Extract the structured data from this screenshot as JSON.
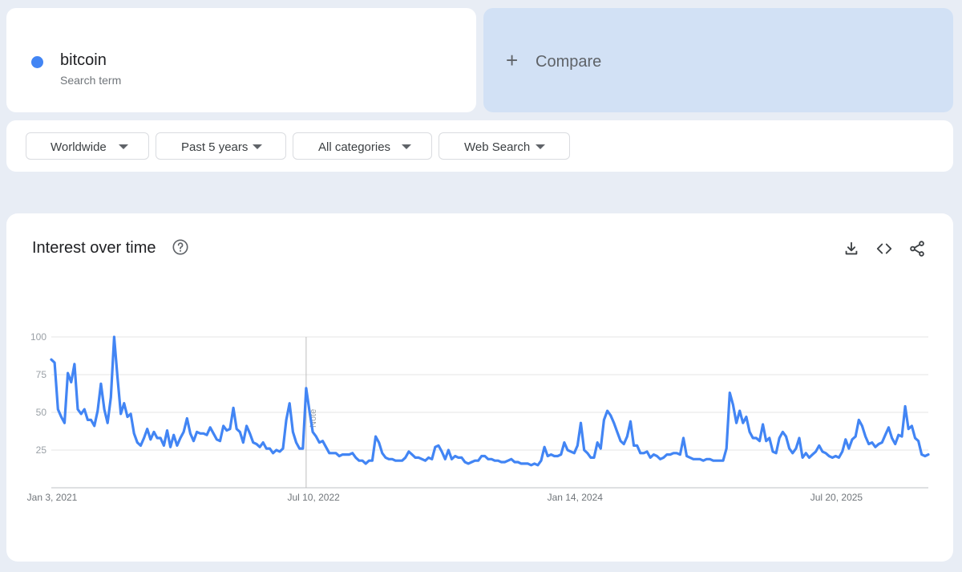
{
  "search_term": {
    "name": "bitcoin",
    "subtitle": "Search term",
    "color": "#4285f4"
  },
  "compare": {
    "label": "Compare",
    "icon": "plus-icon"
  },
  "filters": [
    {
      "label": "Worldwide"
    },
    {
      "label": "Past 5 years"
    },
    {
      "label": "All categories"
    },
    {
      "label": "Web Search"
    }
  ],
  "interest": {
    "title": "Interest over time",
    "icons": [
      "help-icon",
      "download-icon",
      "embed-code-icon",
      "share-icon"
    ]
  },
  "chart_data": {
    "type": "line",
    "title": "Interest over time",
    "ylim": [
      0,
      100
    ],
    "yticks": [
      25,
      50,
      75,
      100
    ],
    "xticks": [
      "Jan 3, 2021",
      "Jul 10, 2022",
      "Jan 14, 2024",
      "Jul 20, 2025"
    ],
    "grid": true,
    "line_color": "#4285f4",
    "note": {
      "label": "Note",
      "week_index": 77
    },
    "series": [
      {
        "name": "bitcoin",
        "values": [
          85,
          83,
          52,
          47,
          43,
          76,
          70,
          82,
          52,
          49,
          52,
          45,
          45,
          41,
          51,
          69,
          52,
          43,
          60,
          100,
          73,
          49,
          56,
          47,
          49,
          36,
          30,
          28,
          33,
          39,
          32,
          37,
          33,
          33,
          28,
          38,
          27,
          35,
          28,
          33,
          37,
          46,
          36,
          31,
          37,
          36,
          36,
          35,
          40,
          36,
          32,
          31,
          41,
          38,
          39,
          53,
          39,
          37,
          30,
          41,
          36,
          30,
          29,
          27,
          30,
          26,
          26,
          23,
          25,
          24,
          26,
          45,
          56,
          37,
          30,
          26,
          26,
          66,
          51,
          37,
          34,
          30,
          31,
          27,
          23,
          23,
          23,
          21,
          22,
          22,
          22,
          23,
          20,
          18,
          18,
          16,
          18,
          18,
          34,
          30,
          23,
          20,
          19,
          19,
          18,
          18,
          18,
          20,
          24,
          22,
          20,
          20,
          19,
          18,
          20,
          19,
          27,
          28,
          24,
          19,
          25,
          19,
          21,
          20,
          20,
          17,
          16,
          17,
          18,
          18,
          21,
          21,
          19,
          19,
          18,
          18,
          17,
          17,
          18,
          19,
          17,
          17,
          16,
          16,
          16,
          15,
          16,
          15,
          18,
          27,
          21,
          22,
          21,
          21,
          22,
          30,
          25,
          24,
          23,
          28,
          43,
          25,
          23,
          20,
          20,
          30,
          26,
          45,
          51,
          48,
          43,
          37,
          31,
          29,
          34,
          44,
          28,
          28,
          23,
          23,
          24,
          20,
          22,
          21,
          19,
          20,
          22,
          22,
          23,
          23,
          22,
          33,
          21,
          20,
          19,
          19,
          19,
          18,
          19,
          19,
          18,
          18,
          18,
          18,
          26,
          63,
          55,
          43,
          51,
          43,
          47,
          37,
          33,
          33,
          31,
          42,
          31,
          33,
          24,
          23,
          33,
          37,
          34,
          26,
          23,
          26,
          33,
          20,
          23,
          20,
          22,
          24,
          28,
          24,
          23,
          21,
          20,
          21,
          20,
          24,
          32,
          26,
          32,
          34,
          45,
          41,
          34,
          29,
          30,
          27,
          29,
          30,
          35,
          40,
          33,
          29,
          35,
          34,
          54,
          39,
          41,
          33,
          31,
          22,
          21,
          22
        ]
      }
    ]
  }
}
